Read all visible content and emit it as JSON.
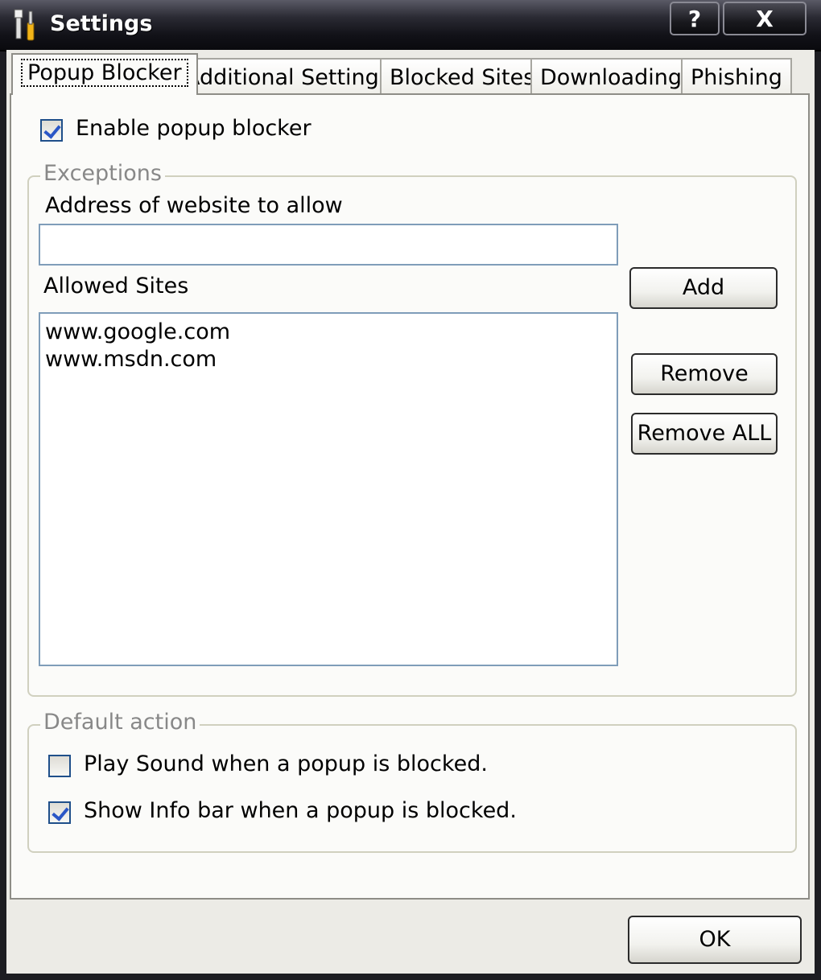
{
  "window": {
    "title": "Settings",
    "help_label": "?",
    "close_label": "X"
  },
  "tabs": [
    {
      "label": "Popup Blocker"
    },
    {
      "label": "Additional Settings"
    },
    {
      "label": "Blocked Sites"
    },
    {
      "label": "Downloading"
    },
    {
      "label": "Phishing"
    }
  ],
  "popup_blocker": {
    "enable_label": "Enable popup blocker",
    "enable_checked": true,
    "exceptions": {
      "title": "Exceptions",
      "address_label": "Address of website to allow",
      "address_value": "",
      "allowed_label": "Allowed Sites",
      "allowed_sites": [
        "www.google.com",
        "www.msdn.com"
      ],
      "add_label": "Add",
      "remove_label": "Remove",
      "remove_all_label": "Remove ALL"
    },
    "default_action": {
      "title": "Default action",
      "play_sound_label": "Play Sound when a popup is blocked.",
      "play_sound_checked": false,
      "show_info_label": "Show Info bar when a popup is blocked.",
      "show_info_checked": true
    }
  },
  "ok_label": "OK"
}
